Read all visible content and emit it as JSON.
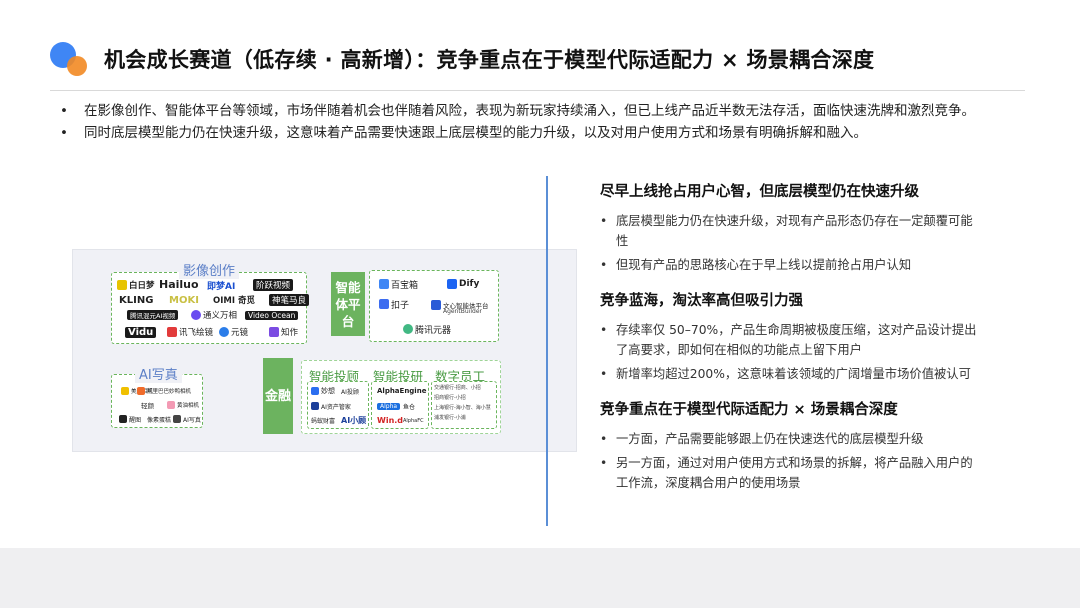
{
  "header": {
    "title": "机会成长赛道（低存续 · 高新增）：竞争重点在于模型代际适配力 × 场景耦合深度"
  },
  "bullets": [
    "在影像创作、智能体平台等领域，市场伴随着机会也伴随着风险，表现为新玩家持续涌入，但已上线产品近半数无法存活，面临快速洗牌和激烈竞争。",
    "同时底层模型能力仍在快速升级，这意味着产品需要快速跟上底层模型的能力升级，以及对用户使用方式和场景有明确拆解和融入。"
  ],
  "right": {
    "sections": [
      {
        "title": "尽早上线抢占用户心智，但底层模型仍在快速升级",
        "points": [
          "底层模型能力仍在快速升级，对现有产品形态仍存在一定颠覆可能性",
          "但现有产品的思路核心在于早上线以提前抢占用户认知"
        ]
      },
      {
        "title": "竞争蓝海，淘汰率高但吸引力强",
        "points": [
          "存续率仅 50–70%，产品生命周期被极度压缩，这对产品设计提出了高要求，即如何在相似的功能点上留下用户",
          "新增率均超过200%，这意味着该领域的广阔增量市场价值被认可"
        ]
      },
      {
        "title": "竞争重点在于模型代际适配力 × 场景耦合深度",
        "points": [
          "一方面，产品需要能够跟上仍在快速迭代的底层模型升级",
          "另一方面，通过对用户使用方式和场景的拆解，将产品融入用户的工作流，深度耦合用户的使用场景"
        ]
      }
    ]
  },
  "diagram": {
    "imaging": {
      "label": "影像创作",
      "logos": [
        "白日梦",
        "Hailuo",
        "即梦AI",
        "阶跃视频",
        "KLING",
        "MOKI",
        "OIMI 奇觅",
        "神笔马良",
        "腾讯混元AI视频",
        "通义万相",
        "Video Ocean",
        "Vidu",
        "讯飞绘镜",
        "元镜",
        "知作"
      ]
    },
    "agent": {
      "label": "智能体平台",
      "logos": [
        "百宝箱",
        "Dify",
        "扣子",
        "文心智能体平台",
        "AgentBuilder",
        "腾讯元器"
      ]
    },
    "portrait": {
      "label": "AI写真",
      "logos": [
        "美颜相机",
        "阿里巴巴",
        "轻颜",
        "黄油相机",
        "醒图",
        "像素蛋糕",
        "妙鸭相机",
        "AI写真"
      ]
    },
    "finance": {
      "label": "金融",
      "groups": [
        {
          "label": "智能投顾",
          "logos": [
            "妙想",
            "AI投顾",
            "AI资产管家",
            "蚂蚁财富",
            "AI小顾"
          ]
        },
        {
          "label": "智能投研",
          "logos": [
            "AlphaEngine",
            "Alpha",
            "鱼仓",
            "Win.d",
            "AlphaFC"
          ]
        },
        {
          "label": "数字员工",
          "lines": [
            "交通银行-招商、小招",
            "招商银行-小招",
            "上海银行-海小智、海小慧",
            "浦发银行-小浦"
          ]
        }
      ]
    }
  },
  "colors": {
    "accent_blue": "#3f86f5",
    "accent_orange": "#f28a24",
    "divider": "#5b8fd6",
    "finance_green": "#6cb35f"
  }
}
